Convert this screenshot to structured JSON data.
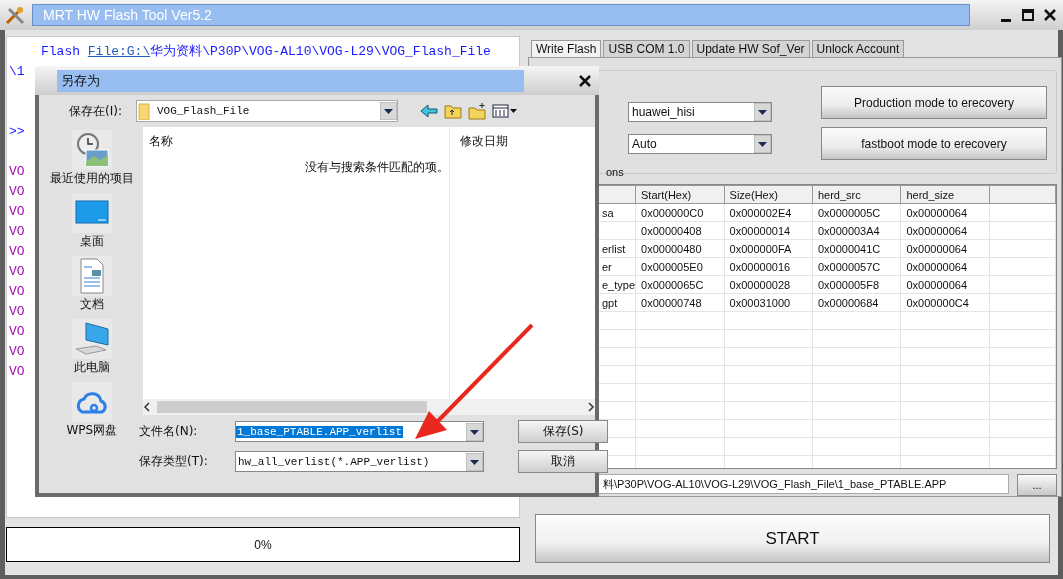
{
  "window": {
    "title": "MRT HW Flash Tool Ver5.2"
  },
  "log": {
    "lines": [
      {
        "kind": "link",
        "prefix": "Flash ",
        "link": "File:G:\\",
        "text": "华为资料\\P30P\\VOG-AL10\\VOG-L29\\VOG_Flash_File"
      },
      {
        "kind": "info",
        "text": "\\1"
      },
      {
        "kind": "prompt",
        "text": ">>"
      },
      {
        "kind": "file",
        "text": "VO"
      },
      {
        "kind": "file",
        "text": "VO"
      },
      {
        "kind": "file",
        "text": "VO"
      },
      {
        "kind": "file",
        "text": "VO"
      },
      {
        "kind": "file",
        "text": "VO"
      },
      {
        "kind": "file",
        "text": "VO"
      },
      {
        "kind": "file",
        "text": "VO"
      },
      {
        "kind": "file",
        "text": "VO"
      },
      {
        "kind": "file",
        "text": "VO"
      },
      {
        "kind": "file",
        "text": "VO"
      },
      {
        "kind": "file",
        "text": "VO"
      }
    ]
  },
  "progress": {
    "level": 0,
    "text": "0%"
  },
  "tabs": [
    {
      "label": "Write Flash",
      "selected": true
    },
    {
      "label": "USB COM 1.0",
      "selected": false
    },
    {
      "label": "Update HW Sof_Ver",
      "selected": false
    },
    {
      "label": "Unlock Account",
      "selected": false
    }
  ],
  "options": {
    "group_label": "ons",
    "platform": "huawei_hisi",
    "mode": "Auto",
    "buttons": [
      "Production mode to erecovery",
      "fastboot mode to erecovery"
    ]
  },
  "table": {
    "columns": [
      "Start(Hex)",
      "Size(Hex)",
      "herd_src",
      "herd_size"
    ],
    "rows": [
      {
        "name": "sa",
        "cells": [
          "0x000000C0",
          "0x000002E4",
          "0x0000005C",
          "0x00000064"
        ]
      },
      {
        "cells": [
          "0x00000408",
          "0x00000014",
          "0x000003A4",
          "0x00000064"
        ]
      },
      {
        "name": "erlist",
        "cells": [
          "0x00000480",
          "0x000000FA",
          "0x0000041C",
          "0x00000064"
        ]
      },
      {
        "name": "er",
        "cells": [
          "0x000005E0",
          "0x00000016",
          "0x0000057C",
          "0x00000064"
        ]
      },
      {
        "name": "e_type",
        "cells": [
          "0x0000065C",
          "0x00000028",
          "0x000005F8",
          "0x00000064"
        ]
      },
      {
        "name": "gpt",
        "cells": [
          "0x00000748",
          "0x00031000",
          "0x00000684",
          "0x000000C4"
        ]
      }
    ]
  },
  "file_path": {
    "value": "料\\P30P\\VOG-AL10\\VOG-L29\\VOG_Flash_File\\1_base_PTABLE.APP",
    "browse": "..."
  },
  "start_button": "START",
  "dialog": {
    "title": "另存为",
    "location_label": "保存在(I):",
    "location": "VOG_Flash_File",
    "places": [
      {
        "kind": "recent",
        "label": "最近使用的项目"
      },
      {
        "kind": "desktop",
        "label": "桌面"
      },
      {
        "kind": "documents",
        "label": "文档"
      },
      {
        "kind": "computer",
        "label": "此电脑"
      },
      {
        "kind": "cloud",
        "label": "WPS网盘"
      }
    ],
    "columns": [
      "名称",
      "修改日期"
    ],
    "empty_message": "没有与搜索条件匹配的项。",
    "file_name_label": "文件名(N):",
    "file_name": {
      "value": "1_base_PTABLE.APP_verlist",
      "selected": true
    },
    "file_type_label": "保存类型(T):",
    "file_type": "hw_all_verlist(*.APP_verlist)",
    "save": "保存(S)",
    "cancel": "取消"
  }
}
